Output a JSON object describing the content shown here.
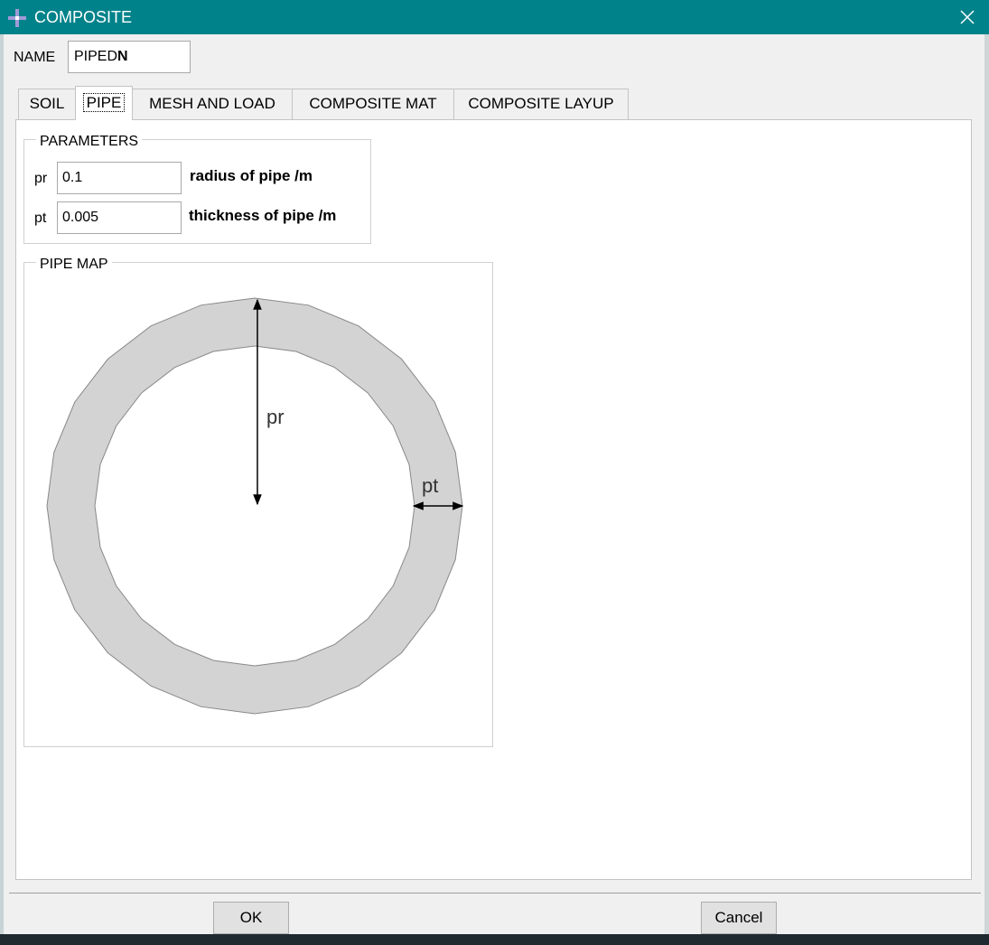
{
  "window": {
    "title": "COMPOSITE"
  },
  "name": {
    "label": "NAME",
    "value_prefix": "PIPED",
    "value_bold": "N"
  },
  "tabs": [
    {
      "label": "SOIL",
      "active": false
    },
    {
      "label": "PIPE",
      "active": true
    },
    {
      "label": "MESH AND LOAD",
      "active": false
    },
    {
      "label": "COMPOSITE MAT",
      "active": false
    },
    {
      "label": "COMPOSITE LAYUP",
      "active": false
    }
  ],
  "parameters": {
    "title": "PARAMETERS",
    "items": [
      {
        "label": "pr",
        "value": "0.1",
        "description": "radius of pipe /m"
      },
      {
        "label": "pt",
        "value": "0.005",
        "description": "thickness of pipe /m"
      }
    ]
  },
  "pipe_map": {
    "title": "PIPE MAP",
    "radius_label": "pr",
    "thickness_label": "pt"
  },
  "buttons": {
    "ok": "OK",
    "cancel": "Cancel"
  },
  "colors": {
    "titlebar": "#00828a",
    "ring_fill": "#d3d3d3"
  }
}
